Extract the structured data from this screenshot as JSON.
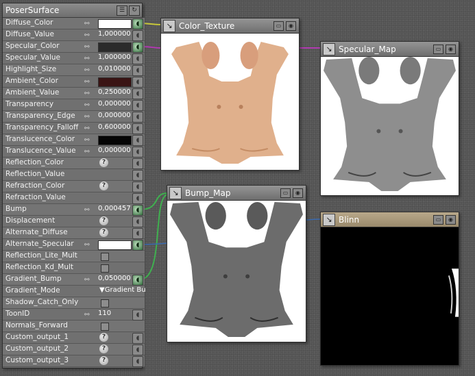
{
  "panel": {
    "title": "PoserSurface",
    "rows": [
      {
        "label": "Diffuse_Color",
        "kind": "swatch",
        "color": "#ffffff",
        "socket": "connected"
      },
      {
        "label": "Diffuse_Value",
        "kind": "value",
        "value": "1,000000",
        "socket": "plain"
      },
      {
        "label": "Specular_Color",
        "kind": "swatch",
        "color": "#2b2b2b",
        "socket": "connected"
      },
      {
        "label": "Specular_Value",
        "kind": "value",
        "value": "1,000000",
        "socket": "plain"
      },
      {
        "label": "Highlight_Size",
        "kind": "value",
        "value": "0,010000",
        "socket": "plain"
      },
      {
        "label": "Ambient_Color",
        "kind": "swatch",
        "color": "#3a1414",
        "socket": "plain"
      },
      {
        "label": "Ambient_Value",
        "kind": "value",
        "value": "0,250000",
        "socket": "plain"
      },
      {
        "label": "Transparency",
        "kind": "value",
        "value": "0,000000",
        "socket": "plain"
      },
      {
        "label": "Transparency_Edge",
        "kind": "value",
        "value": "0,000000",
        "socket": "plain"
      },
      {
        "label": "Transparency_Falloff",
        "kind": "value",
        "value": "0,600000",
        "socket": "plain"
      },
      {
        "label": "Translucence_Color",
        "kind": "swatch",
        "color": "#050505",
        "socket": "plain"
      },
      {
        "label": "Translucence_Value",
        "kind": "value",
        "value": "0,000000",
        "socket": "plain"
      },
      {
        "label": "Reflection_Color",
        "kind": "question",
        "socket": "plain"
      },
      {
        "label": "Reflection_Value",
        "kind": "blank",
        "socket": "plain"
      },
      {
        "label": "Refraction_Color",
        "kind": "question",
        "socket": "plain"
      },
      {
        "label": "Refraction_Value",
        "kind": "blank",
        "socket": "plain"
      },
      {
        "label": "Bump",
        "kind": "value",
        "value": "0,000457",
        "socket": "connected"
      },
      {
        "label": "Displacement",
        "kind": "question",
        "socket": "plain"
      },
      {
        "label": "Alternate_Diffuse",
        "kind": "question",
        "socket": "plain"
      },
      {
        "label": "Alternate_Specular",
        "kind": "swatch",
        "color": "#ffffff",
        "socket": "connected"
      },
      {
        "label": "Reflection_Lite_Mult",
        "kind": "checkbox",
        "socket": "none"
      },
      {
        "label": "Reflection_Kd_Mult",
        "kind": "checkbox",
        "socket": "none"
      },
      {
        "label": "Gradient_Bump",
        "kind": "value",
        "value": "0,050000",
        "socket": "connected"
      },
      {
        "label": "Gradient_Mode",
        "kind": "dropdown",
        "value": "Gradient Bu",
        "socket": "none"
      },
      {
        "label": "Shadow_Catch_Only",
        "kind": "checkbox",
        "socket": "none"
      },
      {
        "label": "ToonID",
        "kind": "value",
        "value": "110",
        "socket": "plain"
      },
      {
        "label": "Normals_Forward",
        "kind": "checkbox",
        "socket": "none"
      },
      {
        "label": "Custom_output_1",
        "kind": "question",
        "socket": "plain"
      },
      {
        "label": "Custom_output_2",
        "kind": "question",
        "socket": "plain"
      },
      {
        "label": "Custom_output_3",
        "kind": "question",
        "socket": "plain"
      }
    ]
  },
  "nodes": {
    "color_texture": {
      "title": "Color_Texture"
    },
    "specular_map": {
      "title": "Specular_Map"
    },
    "bump_map": {
      "title": "Bump_Map"
    },
    "blinn": {
      "title": "Blinn"
    }
  },
  "colors": {
    "wire_green": "#3fb04f",
    "wire_magenta": "#b03ab0",
    "wire_yellow": "#c8c83a",
    "wire_blue": "#3a6ab0",
    "skin": "#e0b08c",
    "gray_map": "#8e8e8e",
    "bump_gray": "#6c6c6c"
  }
}
